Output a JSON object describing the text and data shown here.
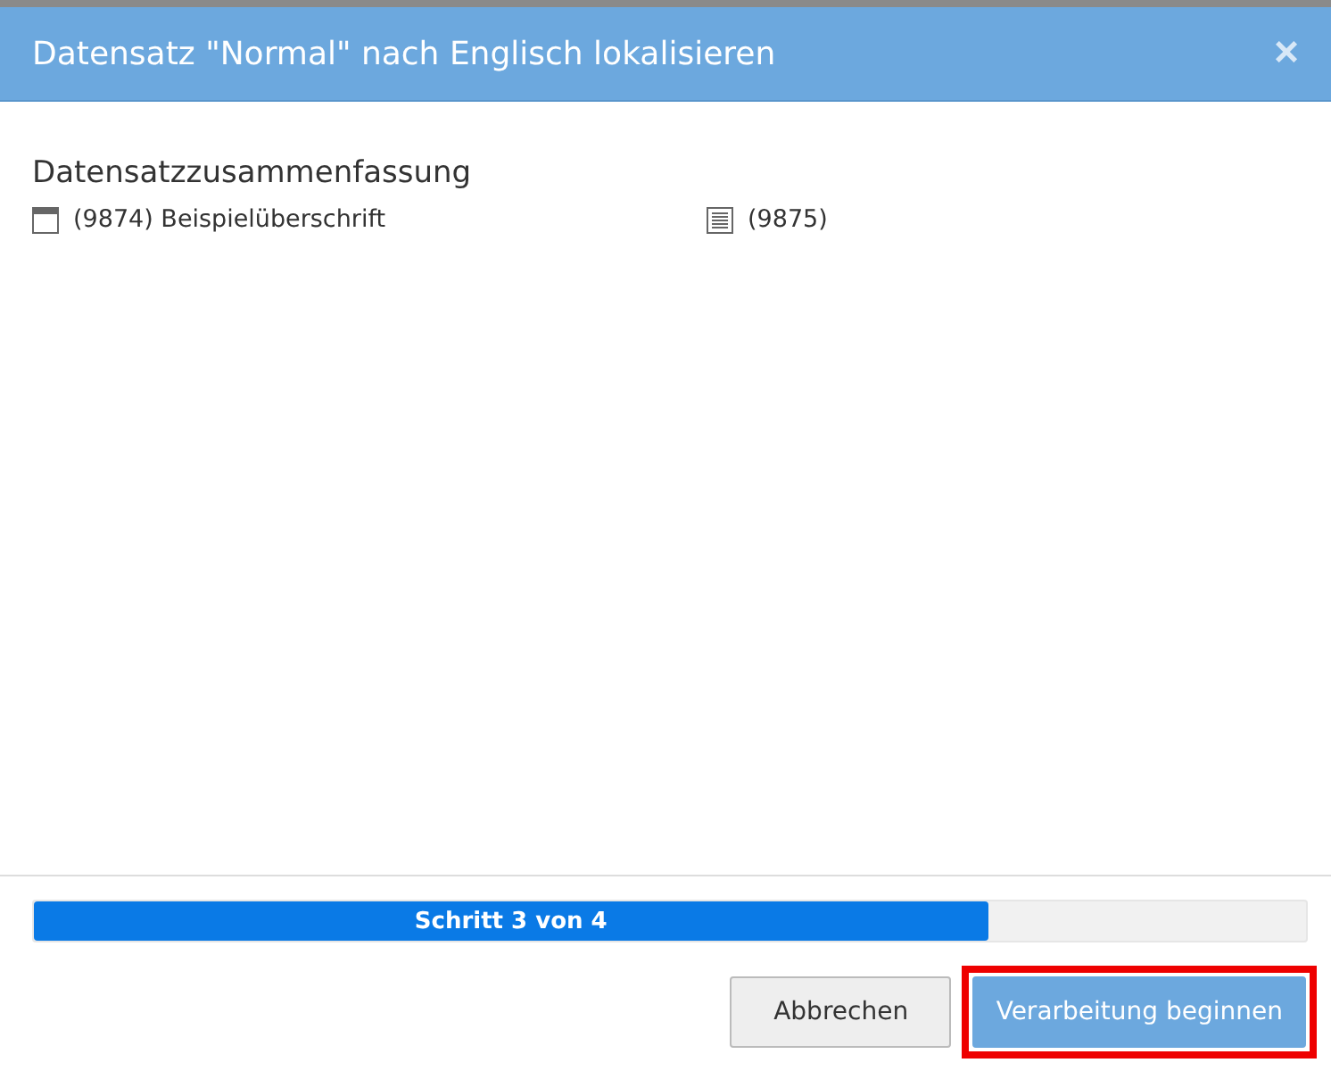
{
  "dialog": {
    "title": "Datensatz \"Normal\" nach Englisch lokalisieren",
    "close": "×"
  },
  "summary": {
    "heading": "Datensatzzusammenfassung",
    "items": [
      {
        "kind": "header",
        "label": "(9874) Beispielüberschrift"
      },
      {
        "kind": "text",
        "label": "(9875)"
      }
    ]
  },
  "progress": {
    "label": "Schritt 3 von 4",
    "level": 0.75
  },
  "buttons": [
    {
      "label": "Abbrechen",
      "kind": "secondary",
      "highlighted": false
    },
    {
      "label": "Verarbeitung beginnen",
      "kind": "primary",
      "highlighted": true
    }
  ]
}
